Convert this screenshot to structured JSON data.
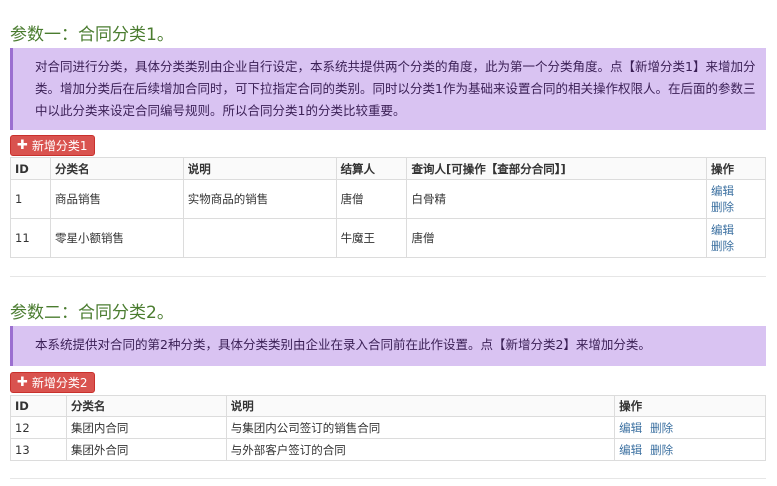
{
  "section1": {
    "title": "参数一：合同分类1。",
    "note": "对合同进行分类，具体分类类别由企业自行设定，本系统共提供两个分类的角度，此为第一个分类角度。点【新增分类1】来增加分类。增加分类后在后续增加合同时，可下拉指定合同的类别。同时以分类1作为基础来设置合同的相关操作权限人。在后面的参数三中以此分类来设定合同编号规则。所以合同分类1的分类比较重要。",
    "add_button": "新增分类1",
    "columns": [
      "ID",
      "分类名",
      "说明",
      "结算人",
      "查询人[可操作【查部分合同】]",
      "操作"
    ],
    "rows": [
      {
        "id": "1",
        "name": "商品销售",
        "desc": "实物商品的销售",
        "settler": "唐僧",
        "viewer": "白骨精",
        "edit": "编辑",
        "delete": "删除"
      },
      {
        "id": "11",
        "name": "零星小额销售",
        "desc": "",
        "settler": "牛魔王",
        "viewer": "唐僧",
        "edit": "编辑",
        "delete": "删除"
      }
    ]
  },
  "section2": {
    "title": "参数二：合同分类2。",
    "note": "本系统提供对合同的第2种分类，具体分类类别由企业在录入合同前在此作设置。点【新增分类2】来增加分类。",
    "add_button": "新增分类2",
    "columns": [
      "ID",
      "分类名",
      "说明",
      "操作"
    ],
    "rows": [
      {
        "id": "12",
        "name": "集团内合同",
        "desc": "与集团内公司签订的销售合同",
        "edit": "编辑",
        "delete": "删除"
      },
      {
        "id": "13",
        "name": "集团外合同",
        "desc": "与外部客户签订的合同",
        "edit": "编辑",
        "delete": "删除"
      }
    ]
  },
  "colors": {
    "title": "#4a7c2f",
    "note_bg": "#d9c3f2",
    "button": "#d9534f",
    "link": "#3a6fa0"
  }
}
